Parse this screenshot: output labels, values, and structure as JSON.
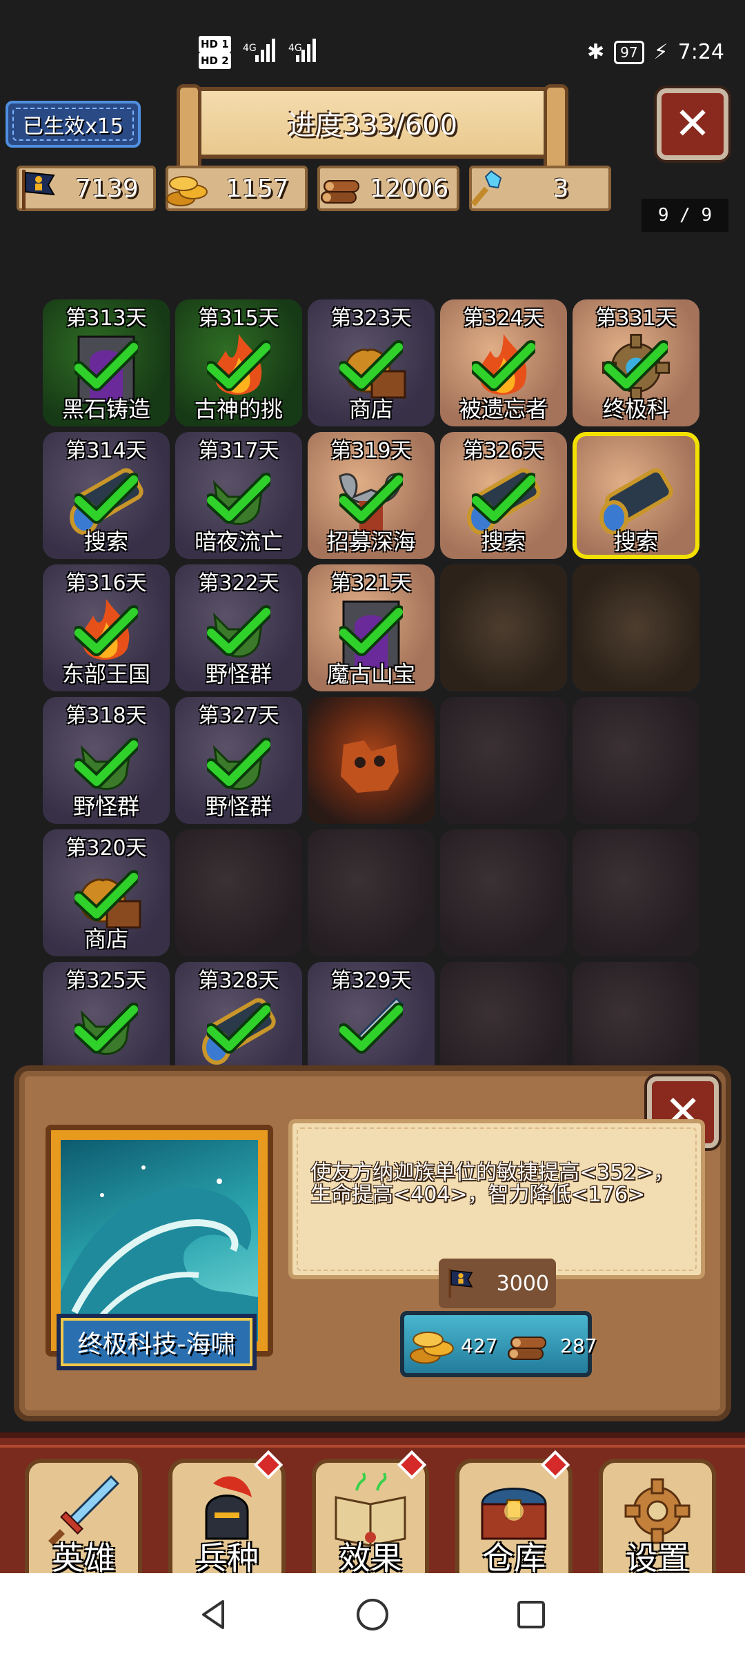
{
  "status_bar": {
    "hd1": "HD 1",
    "hd2": "HD 2",
    "net1": "4G",
    "net2": "4G",
    "battery": "97",
    "time": "7:24"
  },
  "header": {
    "generations_chip": "已生效x15",
    "progress": "进度333/600"
  },
  "resources": [
    {
      "icon": "banner-population-icon",
      "value": "7139"
    },
    {
      "icon": "gold-coins-icon",
      "value": "1157"
    },
    {
      "icon": "wood-logs-icon",
      "value": "12006"
    },
    {
      "icon": "crystal-key-icon",
      "value": "3"
    }
  ],
  "page_indicator": "9 / 9",
  "grid": {
    "tiles": [
      {
        "day": "第313天",
        "label": "黑石铸造",
        "art": "dark-gate-icon",
        "bg": "green",
        "done": true
      },
      {
        "day": "第315天",
        "label": "古神的挑",
        "art": "fire-icon",
        "bg": "green",
        "done": true
      },
      {
        "day": "第323天",
        "label": "商店",
        "art": "treasure-bag-icon",
        "bg": "stone",
        "done": true
      },
      {
        "day": "第324天",
        "label": "被遗忘者",
        "art": "fire-icon",
        "bg": "sand",
        "done": true
      },
      {
        "day": "第331天",
        "label": "终极科",
        "art": "gear-icon",
        "bg": "sand",
        "done": true
      },
      {
        "day": "第314天",
        "label": "搜索",
        "art": "spyglass-icon",
        "bg": "stone",
        "done": true
      },
      {
        "day": "第317天",
        "label": "暗夜流亡",
        "art": "goblin-icon",
        "bg": "stone",
        "done": true
      },
      {
        "day": "第319天",
        "label": "招募深海",
        "art": "axe-warrior-icon",
        "bg": "sand",
        "done": true
      },
      {
        "day": "第326天",
        "label": "搜索",
        "art": "spyglass-icon",
        "bg": "sand",
        "done": true
      },
      {
        "day": "",
        "label": "搜索",
        "art": "spyglass-icon",
        "bg": "sand",
        "done": false,
        "selected": true
      },
      {
        "day": "第316天",
        "label": "东部王国",
        "art": "fire-icon",
        "bg": "stone",
        "done": true
      },
      {
        "day": "第322天",
        "label": "野怪群",
        "art": "goblin-icon",
        "bg": "stone",
        "done": true
      },
      {
        "day": "第321天",
        "label": "魔古山宝",
        "art": "dark-gate-icon",
        "bg": "sand",
        "done": true
      },
      {
        "day": "",
        "label": "",
        "art": "",
        "bg": "dim",
        "done": false
      },
      {
        "day": "",
        "label": "",
        "art": "",
        "bg": "dim",
        "done": false
      },
      {
        "day": "第318天",
        "label": "野怪群",
        "art": "goblin-icon",
        "bg": "stone",
        "done": true
      },
      {
        "day": "第327天",
        "label": "野怪群",
        "art": "goblin-icon",
        "bg": "stone",
        "done": true
      },
      {
        "day": "",
        "label": "",
        "art": "",
        "bg": "lava",
        "done": false
      },
      {
        "day": "",
        "label": "",
        "art": "",
        "bg": "dark",
        "done": false
      },
      {
        "day": "",
        "label": "",
        "art": "",
        "bg": "dark",
        "done": false
      },
      {
        "day": "第320天",
        "label": "商店",
        "art": "treasure-bag-icon",
        "bg": "stone",
        "done": true
      },
      {
        "day": "",
        "label": "",
        "art": "",
        "bg": "dark",
        "done": false
      },
      {
        "day": "",
        "label": "",
        "art": "",
        "bg": "dark",
        "done": false
      },
      {
        "day": "",
        "label": "",
        "art": "",
        "bg": "dark",
        "done": false
      },
      {
        "day": "",
        "label": "",
        "art": "",
        "bg": "dark",
        "done": false
      },
      {
        "day": "第325天",
        "label": "",
        "art": "goblin-icon",
        "bg": "stone",
        "done": true
      },
      {
        "day": "第328天",
        "label": "",
        "art": "spyglass-icon",
        "bg": "stone",
        "done": true
      },
      {
        "day": "第329天",
        "label": "",
        "art": "sword-icon",
        "bg": "stone",
        "done": true
      },
      {
        "day": "",
        "label": "",
        "art": "",
        "bg": "dark",
        "done": false
      },
      {
        "day": "",
        "label": "",
        "art": "",
        "bg": "dark",
        "done": false
      }
    ]
  },
  "detail": {
    "name": "终极科技-海啸",
    "description": "使友方纳迦族单位的敏捷提高<352>，生命提高<404>，智力降低<176>",
    "requirement": "3000",
    "cost_gold": "427",
    "cost_wood": "287"
  },
  "nav": [
    {
      "label": "英雄",
      "icon": "sword-icon",
      "badge": false
    },
    {
      "label": "兵种",
      "icon": "helmet-icon",
      "badge": true
    },
    {
      "label": "效果",
      "icon": "spellbook-icon",
      "badge": true
    },
    {
      "label": "仓库",
      "icon": "treasure-chest-icon",
      "badge": true
    },
    {
      "label": "设置",
      "icon": "gear-icon",
      "badge": false
    }
  ],
  "colors": {
    "selected_border": "#f2e100",
    "check": "#2fd12a",
    "panel": "#a37248",
    "nav": "#7b2a1e"
  }
}
